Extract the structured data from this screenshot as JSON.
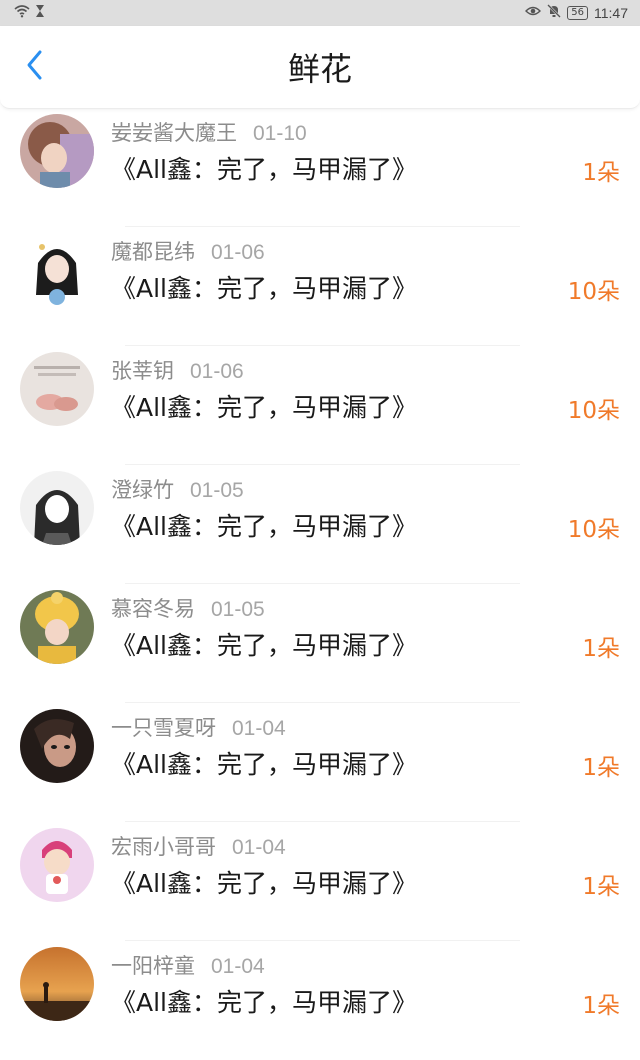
{
  "status_bar": {
    "time": "11:47",
    "battery": "56"
  },
  "header": {
    "title": "鲜花"
  },
  "colors": {
    "accent_blue": "#2a8ff0",
    "count_orange": "#f07a2a",
    "status_bar_bg": "#dedede"
  },
  "rows": [
    {
      "name": "妛妛酱大魔王",
      "date": "01-10",
      "work": "《All鑫：完了，马甲漏了》",
      "count": "1朵"
    },
    {
      "name": "魔都昆纬",
      "date": "01-06",
      "work": "《All鑫：完了，马甲漏了》",
      "count": "10朵"
    },
    {
      "name": "张莘钥",
      "date": "01-06",
      "work": "《All鑫：完了，马甲漏了》",
      "count": "10朵"
    },
    {
      "name": "澄绿竹",
      "date": "01-05",
      "work": "《All鑫：完了，马甲漏了》",
      "count": "10朵"
    },
    {
      "name": "慕容冬易",
      "date": "01-05",
      "work": "《All鑫：完了，马甲漏了》",
      "count": "1朵"
    },
    {
      "name": "一只雪夏呀",
      "date": "01-04",
      "work": "《All鑫：完了，马甲漏了》",
      "count": "1朵"
    },
    {
      "name": "宏雨小哥哥",
      "date": "01-04",
      "work": "《All鑫：完了，马甲漏了》",
      "count": "1朵"
    },
    {
      "name": "一阳梓童",
      "date": "01-04",
      "work": "《All鑫：完了，马甲漏了》",
      "count": "1朵"
    }
  ]
}
